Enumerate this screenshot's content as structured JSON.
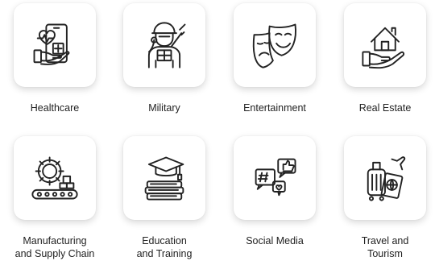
{
  "items": [
    {
      "label": "Healthcare",
      "icon": "healthcare-phone-heart-icon"
    },
    {
      "label": "Military",
      "icon": "soldier-icon"
    },
    {
      "label": "Entertainment",
      "icon": "theater-masks-icon"
    },
    {
      "label": "Real Estate",
      "icon": "house-in-hand-icon"
    },
    {
      "label": "Manufacturing\nand Supply Chain",
      "icon": "gear-conveyor-icon"
    },
    {
      "label": "Education\nand Training",
      "icon": "graduation-cap-books-icon"
    },
    {
      "label": "Social Media",
      "icon": "social-bubbles-icon"
    },
    {
      "label": "Travel and\nTourism",
      "icon": "luggage-passport-icon"
    }
  ]
}
